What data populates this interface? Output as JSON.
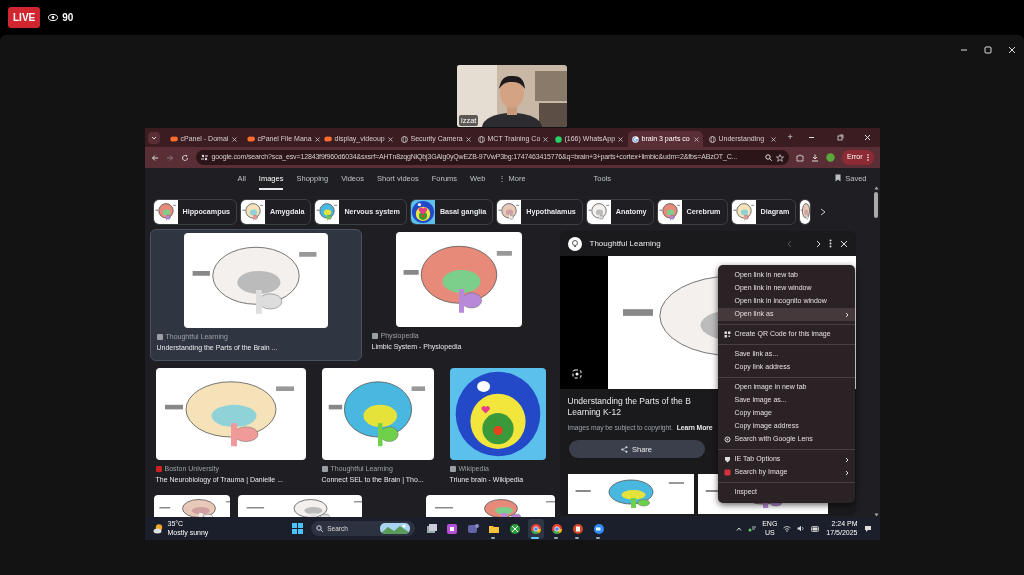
{
  "stream": {
    "badge": "LIVE",
    "viewers": "90"
  },
  "webcam": {
    "name": "izzat"
  },
  "browser": {
    "tabs": [
      {
        "title": "cPanel - Domai",
        "kind": "cpanel",
        "selected": false
      },
      {
        "title": "cPanel File Mana",
        "kind": "cpanel",
        "selected": false
      },
      {
        "title": "display_videoup",
        "kind": "cpanel",
        "selected": false
      },
      {
        "title": "Security Camera",
        "kind": "globe",
        "selected": false
      },
      {
        "title": "MCT Training Co",
        "kind": "globe",
        "selected": false
      },
      {
        "title": "(166) WhatsApp",
        "kind": "whatsapp",
        "selected": false
      },
      {
        "title": "brain 3 parts co",
        "kind": "google",
        "selected": true
      },
      {
        "title": "Understanding",
        "kind": "globe",
        "selected": false
      }
    ],
    "new_tab": "+",
    "url": "google.com/search?sca_esv=12843f9f960d6034&sxsrf=AHTn8zqgNiQbj3GAlg0yQwEZB-97VwP3bg:1747463415776&q=brain+3+parts+cortex+limbic&udm=2&fbs=ABzOT_C...",
    "profile_badge": "Error"
  },
  "search": {
    "nav": [
      {
        "label": "All",
        "selected": false
      },
      {
        "label": "Images",
        "selected": true
      },
      {
        "label": "Shopping",
        "selected": false
      },
      {
        "label": "Videos",
        "selected": false
      },
      {
        "label": "Short videos",
        "selected": false
      },
      {
        "label": "Forums",
        "selected": false
      },
      {
        "label": "Web",
        "selected": false
      },
      {
        "label": "⋮ More",
        "selected": false
      }
    ],
    "tools": "Tools",
    "saved": "Saved",
    "chips": [
      "Hippocampus",
      "Amygdala",
      "Nervous system",
      "Basal ganglia",
      "Hypothalamus",
      "Anatomy",
      "Cerebrum",
      "Diagram"
    ]
  },
  "result_rows": [
    [
      {
        "source": "Thoughtful Learning",
        "title": "Understanding the Parts of the Brain ...",
        "selected": true,
        "color": "#9aa0a6"
      },
      {
        "source": "Physiopedia",
        "title": "Limbic System - Physiopedia",
        "selected": false,
        "color": "#9aa0a6"
      }
    ],
    [
      {
        "source": "Boston University",
        "title": "The Neurobiology of Trauma | Danielle ...",
        "selected": false,
        "color": "#cc2222"
      },
      {
        "source": "Thoughtful Learning",
        "title": "Connect SEL to the Brain | Tho...",
        "selected": false,
        "color": "#9aa0a6"
      },
      {
        "source": "Wikipedia",
        "title": "Triune brain - Wikipedia",
        "selected": false,
        "color": "#9aa0a6"
      }
    ],
    [
      {
        "kind": "picture"
      },
      {
        "kind": "picture"
      },
      {
        "kind": "picture"
      }
    ]
  ],
  "panel": {
    "source": "Thoughtful Learning",
    "title_lines": [
      "Understanding the Parts of the B",
      "Learning K-12"
    ],
    "copyright": "Images may be subject to copyright.",
    "learn_more": "Learn More",
    "share": "Share"
  },
  "context_menu": {
    "items": [
      {
        "kind": "plain",
        "label": "Open link in new tab",
        "submenu": false,
        "highlighted": false
      },
      {
        "kind": "plain",
        "label": "Open link in new window",
        "submenu": false,
        "highlighted": false
      },
      {
        "kind": "plain",
        "label": "Open link in incognito window",
        "submenu": false,
        "highlighted": false
      },
      {
        "kind": "plain",
        "label": "Open link as",
        "submenu": true,
        "highlighted": true
      },
      {
        "kind": "separator"
      },
      {
        "kind": "qr",
        "label": "Create QR Code for this image",
        "submenu": false,
        "highlighted": false
      },
      {
        "kind": "separator"
      },
      {
        "kind": "plain",
        "label": "Save link as...",
        "submenu": false,
        "highlighted": false
      },
      {
        "kind": "plain",
        "label": "Copy link address",
        "submenu": false,
        "highlighted": false
      },
      {
        "kind": "separator"
      },
      {
        "kind": "plain",
        "label": "Open image in new tab",
        "submenu": false,
        "highlighted": false
      },
      {
        "kind": "plain",
        "label": "Save image as...",
        "submenu": false,
        "highlighted": false
      },
      {
        "kind": "plain",
        "label": "Copy image",
        "submenu": false,
        "highlighted": false
      },
      {
        "kind": "plain",
        "label": "Copy image address",
        "submenu": false,
        "highlighted": false
      },
      {
        "kind": "lens",
        "label": "Search with Google Lens",
        "submenu": false,
        "highlighted": false
      },
      {
        "kind": "separator"
      },
      {
        "kind": "shield",
        "label": "IE Tab Options",
        "submenu": true,
        "highlighted": false
      },
      {
        "kind": "red",
        "label": "Search by Image",
        "submenu": true,
        "highlighted": false
      },
      {
        "kind": "separator"
      },
      {
        "kind": "plain",
        "label": "Inspect",
        "submenu": false,
        "highlighted": false
      }
    ]
  },
  "taskbar": {
    "temperature": "35°C",
    "weather": "Mostly sunny",
    "search": "Search",
    "apps": [
      {
        "kind": "stack",
        "running": false,
        "selected": false
      },
      {
        "kind": "pink",
        "running": false,
        "selected": false
      },
      {
        "kind": "teams",
        "running": false,
        "selected": false
      },
      {
        "kind": "folder",
        "running": true,
        "selected": false
      },
      {
        "kind": "xbox",
        "running": false,
        "selected": false
      },
      {
        "kind": "chrome",
        "running": true,
        "selected": true
      },
      {
        "kind": "chrome",
        "running": true,
        "selected": false
      },
      {
        "kind": "ppt",
        "running": true,
        "selected": false
      },
      {
        "kind": "zoom",
        "running": true,
        "selected": false
      }
    ],
    "lang": "ENG",
    "region": "US",
    "time": "2:24 PM",
    "date": "17/5/2025"
  }
}
